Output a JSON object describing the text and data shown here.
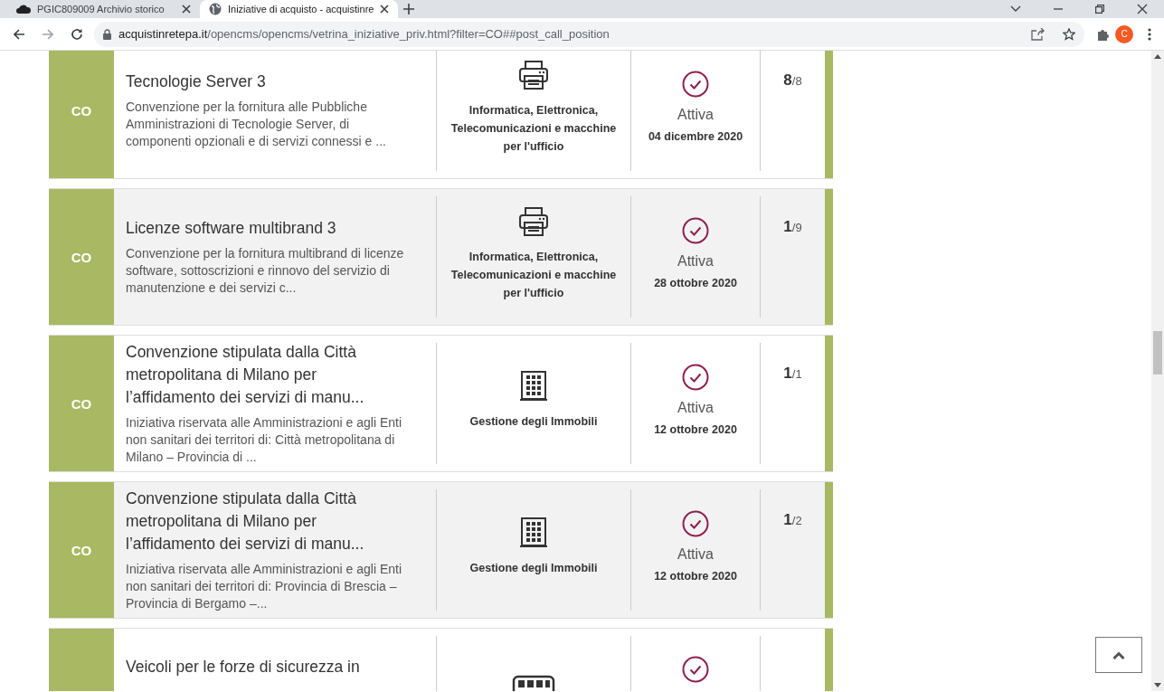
{
  "browser": {
    "tabs": [
      {
        "title": "PGIC809009 Archivio storico",
        "selected": false
      },
      {
        "title": "Iniziative di acquisto - acquistinre",
        "selected": true
      }
    ],
    "address": {
      "domain": "acquistinretepa.it",
      "path": "/opencms/opencms/vetrina_iniziative_priv.html?filter=CO##post_call_position"
    },
    "profile_initial": "C"
  },
  "cards": [
    {
      "kind": "printer",
      "badge": "CO",
      "title": "Tecnologie Server 3",
      "description": "Convenzione per la fornitura alle Pubbliche Amministrazioni di Tecnologie Server, di componenti opzionali e di servizi connessi e ...",
      "category": "Informatica, Elettronica, Telecomunicazioni e macchine per l'ufficio",
      "status": "Attiva",
      "date": "04 dicembre 2020",
      "count": "8",
      "total": "/8"
    },
    {
      "kind": "printer",
      "badge": "CO",
      "title": "Licenze software multibrand 3",
      "description": "Convenzione per la fornitura multibrand di licenze software, sottoscrizioni e rinnovo del servizio di manutenzione e dei servizi c...",
      "category": "Informatica, Elettronica, Telecomunicazioni e macchine per l'ufficio",
      "status": "Attiva",
      "date": "28 ottobre 2020",
      "count": "1",
      "total": "/9"
    },
    {
      "kind": "building",
      "badge": "CO",
      "title": "Convenzione stipulata dalla Città metropolitana di Milano per l’affidamento dei servizi di manu...",
      "description": "Iniziativa riservata alle Amministrazioni e agli Enti non sanitari dei territori di: Città metropolitana di Milano – Provincia di ...",
      "category": "Gestione degli Immobili",
      "status": "Attiva",
      "date": "12 ottobre 2020",
      "count": "1",
      "total": "/1"
    },
    {
      "kind": "building",
      "badge": "CO",
      "title": "Convenzione stipulata dalla Città metropolitana di Milano per l’affidamento dei servizi di manu...",
      "description": "Iniziativa riservata alle Amministrazioni e agli Enti non sanitari dei territori di: Provincia di Brescia – Provincia di Bergamo –...",
      "category": "Gestione degli Immobili",
      "status": "Attiva",
      "date": "12 ottobre 2020",
      "count": "1",
      "total": "/2"
    },
    {
      "kind": "vehicle",
      "title": "Veicoli per le forze di sicurezza in"
    }
  ]
}
